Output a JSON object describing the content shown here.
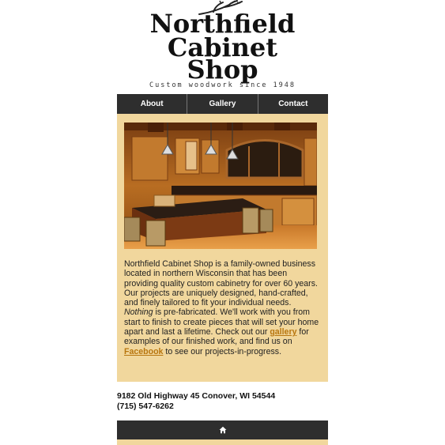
{
  "logo": {
    "line1": "Northfield",
    "line2": "Cabinet",
    "line3": "Shop",
    "tagline": "Custom woodwork since 1948"
  },
  "nav": {
    "items": [
      {
        "label": "About"
      },
      {
        "label": "Gallery"
      },
      {
        "label": "Contact"
      }
    ]
  },
  "hero": {
    "icon": "kitchen-photo"
  },
  "about": {
    "part1": "Northfield Cabinet Shop is a family-owned business located in northern Wisconsin that has been providing quality custom cabinetry for over 60 years. Our projects are uniquely designed, hand-crafted, and finely tailored to fit your individual needs. ",
    "emphasis": "Nothing",
    "part2": " is pre-fabricated. We'll work with you from start to finish to create pieces that will set your home apart and last a lifetime. Check out our ",
    "gallery_link": "gallery",
    "part3": " for examples of our finished work, and find us on ",
    "facebook_link": "Facebook",
    "part4": " to see our projects-in-progress."
  },
  "contact": {
    "address": "9182 Old Highway 45 Conover, WI 54544",
    "phone": "(715) 547-6262"
  },
  "footer": {
    "icon": "home-icon"
  },
  "colors": {
    "panel": "#f1d79d",
    "nav": "#2e2e2e",
    "link": "#b8760f"
  }
}
